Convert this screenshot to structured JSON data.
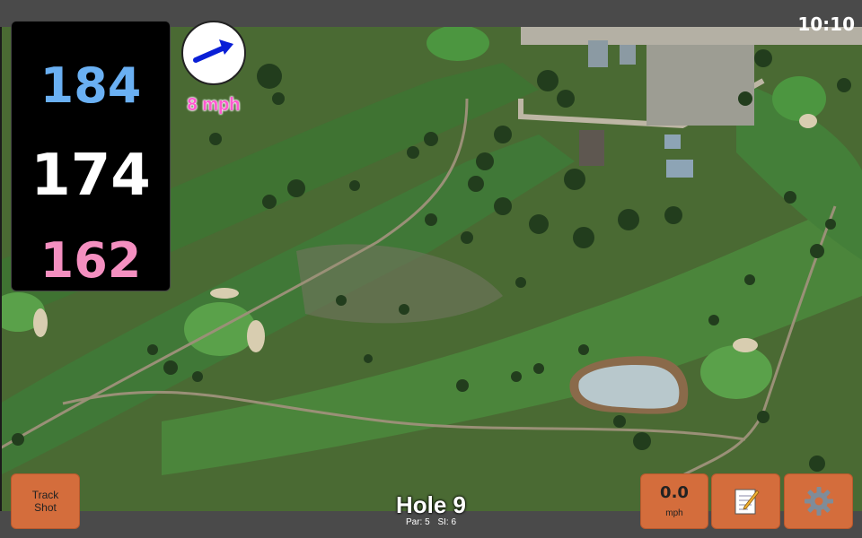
{
  "status_bar": {
    "time": "10:10"
  },
  "distances": {
    "back": "184",
    "middle": "174",
    "front": "162"
  },
  "wind_indicator": {
    "speed_label": "8 mph",
    "arrow_icon": "wind-arrow-icon"
  },
  "buttons": {
    "track_shot_line1": "Track",
    "track_shot_line2": "Shot",
    "wind_value": "0.0",
    "wind_unit": "mph",
    "notes_icon": "notepad-icon",
    "settings_icon": "gear-icon"
  },
  "hole": {
    "title": "Hole 9",
    "par": "Par: 5",
    "si": "SI: 6"
  },
  "colors": {
    "accent_button": "#d46d3c",
    "back_distance": "#6ab0f3",
    "front_distance": "#f48fc0",
    "wind_text": "#ff5ad0"
  }
}
